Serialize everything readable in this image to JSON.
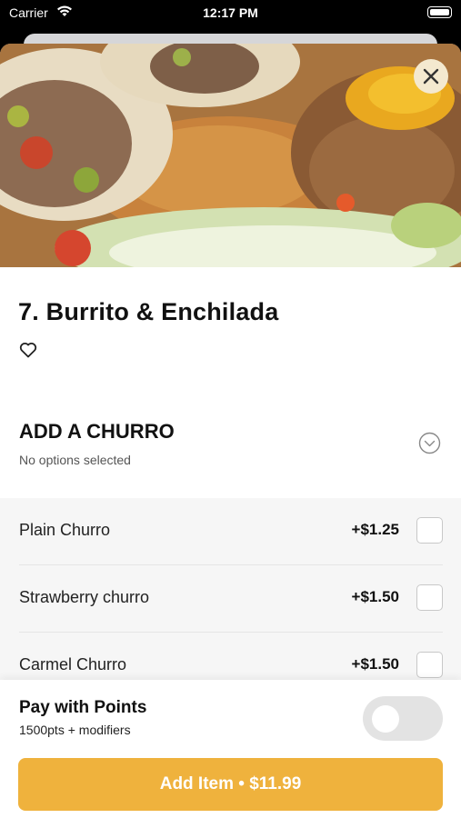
{
  "status_bar": {
    "carrier": "Carrier",
    "time": "12:17 PM"
  },
  "item": {
    "title": "7.  Burrito & Enchilada"
  },
  "section": {
    "title": "ADD A CHURRO",
    "subtitle": "No options selected"
  },
  "options": [
    {
      "name": "Plain Churro",
      "price": "+$1.25",
      "checked": false
    },
    {
      "name": "Strawberry churro",
      "price": "+$1.50",
      "checked": false
    },
    {
      "name": "Carmel Churro",
      "price": "+$1.50",
      "checked": false
    }
  ],
  "pay_points": {
    "title": "Pay with Points",
    "subtitle": "1500pts + modifiers",
    "enabled": false
  },
  "add_button": {
    "label": "Add Item • $11.99"
  },
  "icons": {
    "close": "close-icon",
    "favorite": "heart-icon",
    "expand": "chevron-down-circle-icon",
    "wifi": "wifi-icon",
    "battery": "battery-icon"
  },
  "colors": {
    "accent": "#efb23d",
    "close_bg": "#f4e9cf"
  }
}
